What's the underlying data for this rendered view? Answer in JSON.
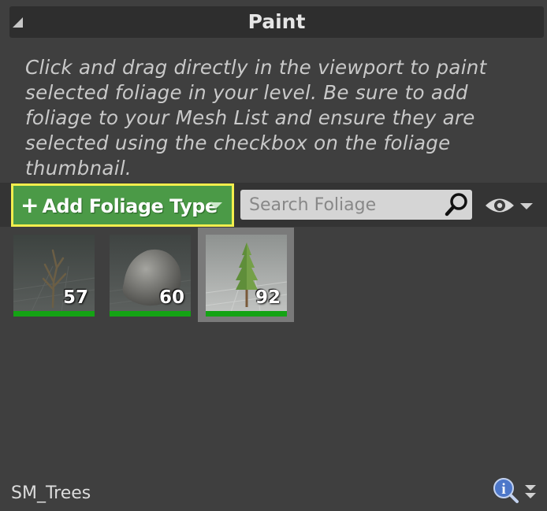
{
  "panel": {
    "title": "Paint",
    "instructions": "Click and drag directly in the viewport to paint selected foliage in your level. Be sure to add foliage to your Mesh List and ensure they are selected using the checkbox on the foliage thumbnail."
  },
  "toolbar": {
    "add_button": {
      "plus": "+",
      "label": "Add Foliage Type"
    },
    "search": {
      "placeholder": "Search Foliage",
      "value": ""
    }
  },
  "foliage_types": [
    {
      "icon": "dead-tree-icon",
      "count": "57"
    },
    {
      "icon": "rock-icon",
      "count": "60"
    },
    {
      "icon": "pine-tree-icon",
      "count": "92"
    }
  ],
  "footer": {
    "selected_item": "SM_Trees"
  },
  "colors": {
    "add_button_bg": "#4b9a47",
    "highlight_border": "#f2ee4d",
    "thumb_bar": "#14a314",
    "panel_bg": "#3f3f3f"
  }
}
